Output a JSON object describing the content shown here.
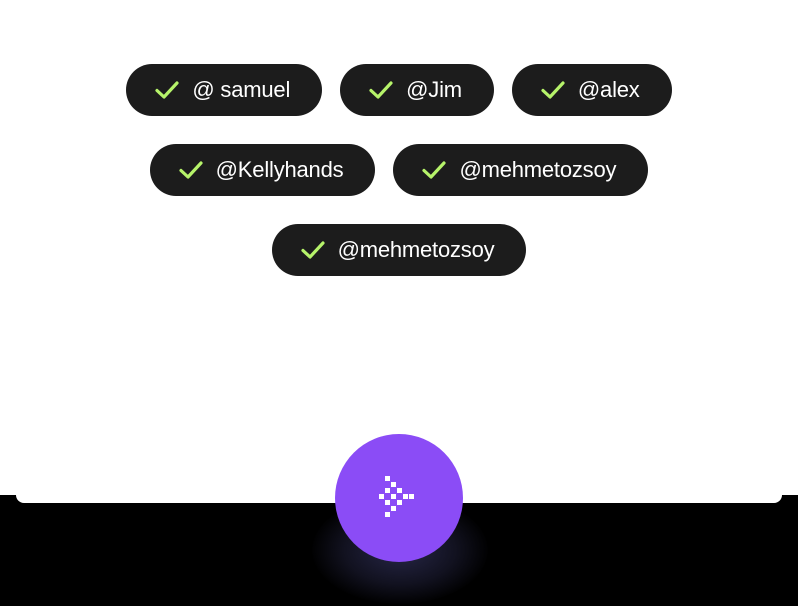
{
  "tags": [
    {
      "label": "@ samuel",
      "icon": "check-icon"
    },
    {
      "label": "@Jim",
      "icon": "check-icon"
    },
    {
      "label": "@alex",
      "icon": "check-icon"
    },
    {
      "label": "@Kellyhands",
      "icon": "check-icon"
    },
    {
      "label": "@mehmetozsoy",
      "icon": "check-icon"
    },
    {
      "label": "@mehmetozsoy",
      "icon": "check-icon"
    }
  ],
  "colors": {
    "tag_background": "#1c1c1c",
    "check": "#b6f36a",
    "fab_background": "#8b4cf6",
    "card_background": "#ffffff",
    "page_background": "#000000"
  },
  "fab": {
    "icon": "pixel-arrow-right-icon"
  }
}
